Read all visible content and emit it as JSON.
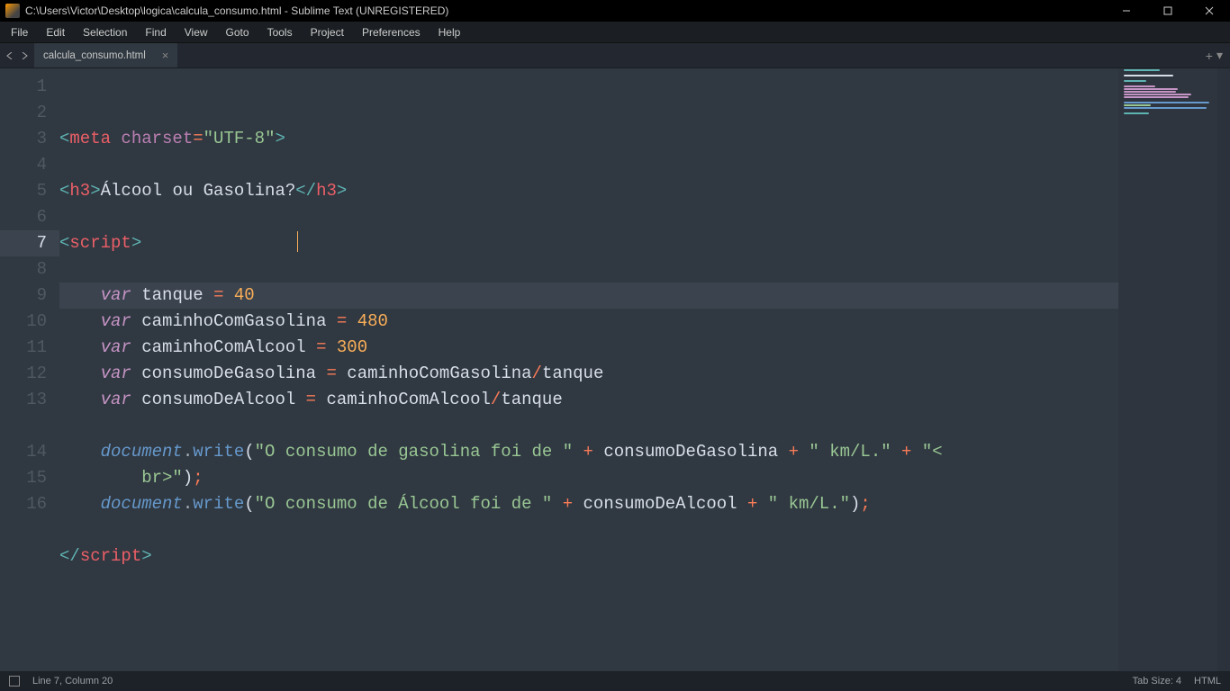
{
  "window": {
    "title": "C:\\Users\\Victor\\Desktop\\logica\\calcula_consumo.html - Sublime Text (UNREGISTERED)"
  },
  "menu": {
    "items": [
      "File",
      "Edit",
      "Selection",
      "Find",
      "View",
      "Goto",
      "Tools",
      "Project",
      "Preferences",
      "Help"
    ]
  },
  "tabs": {
    "active": {
      "label": "calcula_consumo.html"
    }
  },
  "status": {
    "position": "Line 7, Column 20",
    "tab_size": "Tab Size: 4",
    "syntax": "HTML"
  },
  "code": {
    "lines": [
      {
        "num": 1,
        "tokens": [
          [
            "p-ang",
            "<"
          ],
          [
            "p-tag",
            "meta"
          ],
          [
            "p-text",
            " "
          ],
          [
            "p-attr",
            "charset"
          ],
          [
            "p-op",
            "="
          ],
          [
            "p-str",
            "\"UTF-8\""
          ],
          [
            "p-ang",
            ">"
          ]
        ]
      },
      {
        "num": 2,
        "tokens": []
      },
      {
        "num": 3,
        "tokens": [
          [
            "p-ang",
            "<"
          ],
          [
            "p-tag",
            "h3"
          ],
          [
            "p-ang",
            ">"
          ],
          [
            "p-text",
            "Álcool ou Gasolina?"
          ],
          [
            "p-ang",
            "</"
          ],
          [
            "p-tag",
            "h3"
          ],
          [
            "p-ang",
            ">"
          ]
        ]
      },
      {
        "num": 4,
        "tokens": []
      },
      {
        "num": 5,
        "tokens": [
          [
            "p-ang",
            "<"
          ],
          [
            "p-tag",
            "script"
          ],
          [
            "p-ang",
            ">"
          ]
        ]
      },
      {
        "num": 6,
        "tokens": []
      },
      {
        "num": 7,
        "current": true,
        "indent": "    ",
        "tokens": [
          [
            "p-kw",
            "var"
          ],
          [
            "p-text",
            " "
          ],
          [
            "p-id",
            "tanque"
          ],
          [
            "p-text",
            " "
          ],
          [
            "p-op",
            "="
          ],
          [
            "p-text",
            " "
          ],
          [
            "p-num",
            "40"
          ]
        ]
      },
      {
        "num": 8,
        "indent": "    ",
        "tokens": [
          [
            "p-kw",
            "var"
          ],
          [
            "p-text",
            " "
          ],
          [
            "p-id",
            "caminhoComGasolina"
          ],
          [
            "p-text",
            " "
          ],
          [
            "p-op",
            "="
          ],
          [
            "p-text",
            " "
          ],
          [
            "p-num",
            "480"
          ]
        ]
      },
      {
        "num": 9,
        "indent": "    ",
        "tokens": [
          [
            "p-kw",
            "var"
          ],
          [
            "p-text",
            " "
          ],
          [
            "p-id",
            "caminhoComAlcool"
          ],
          [
            "p-text",
            " "
          ],
          [
            "p-op",
            "="
          ],
          [
            "p-text",
            " "
          ],
          [
            "p-num",
            "300"
          ]
        ]
      },
      {
        "num": 10,
        "indent": "    ",
        "tokens": [
          [
            "p-kw",
            "var"
          ],
          [
            "p-text",
            " "
          ],
          [
            "p-id",
            "consumoDeGasolina"
          ],
          [
            "p-text",
            " "
          ],
          [
            "p-op",
            "="
          ],
          [
            "p-text",
            " "
          ],
          [
            "p-id",
            "caminhoComGasolina"
          ],
          [
            "p-op",
            "/"
          ],
          [
            "p-id",
            "tanque"
          ]
        ]
      },
      {
        "num": 11,
        "indent": "    ",
        "tokens": [
          [
            "p-kw",
            "var"
          ],
          [
            "p-text",
            " "
          ],
          [
            "p-id",
            "consumoDeAlcool"
          ],
          [
            "p-text",
            " "
          ],
          [
            "p-op",
            "="
          ],
          [
            "p-text",
            " "
          ],
          [
            "p-id",
            "caminhoComAlcool"
          ],
          [
            "p-op",
            "/"
          ],
          [
            "p-id",
            "tanque"
          ]
        ]
      },
      {
        "num": 12,
        "tokens": []
      },
      {
        "num": 13,
        "indent": "    ",
        "tokens": [
          [
            "p-obj",
            "document"
          ],
          [
            "p-dot",
            "."
          ],
          [
            "p-fn",
            "write"
          ],
          [
            "p-text",
            "("
          ],
          [
            "p-str",
            "\"O consumo de gasolina foi de \""
          ],
          [
            "p-text",
            " "
          ],
          [
            "p-op",
            "+"
          ],
          [
            "p-text",
            " "
          ],
          [
            "p-id",
            "consumoDeGasolina"
          ],
          [
            "p-text",
            " "
          ],
          [
            "p-op",
            "+"
          ],
          [
            "p-text",
            " "
          ],
          [
            "p-str",
            "\" km/L.\""
          ],
          [
            "p-text",
            " "
          ],
          [
            "p-op",
            "+"
          ],
          [
            "p-text",
            " "
          ],
          [
            "p-str",
            "\"<"
          ]
        ],
        "wrap": {
          "indent": "        ",
          "tokens": [
            [
              "p-str",
              "br>\""
            ],
            [
              "p-text",
              ")"
            ],
            [
              "p-op",
              ";"
            ]
          ]
        }
      },
      {
        "num": 14,
        "indent": "    ",
        "tokens": [
          [
            "p-obj",
            "document"
          ],
          [
            "p-dot",
            "."
          ],
          [
            "p-fn",
            "write"
          ],
          [
            "p-text",
            "("
          ],
          [
            "p-str",
            "\"O consumo de Álcool foi de \""
          ],
          [
            "p-text",
            " "
          ],
          [
            "p-op",
            "+"
          ],
          [
            "p-text",
            " "
          ],
          [
            "p-id",
            "consumoDeAlcool"
          ],
          [
            "p-text",
            " "
          ],
          [
            "p-op",
            "+"
          ],
          [
            "p-text",
            " "
          ],
          [
            "p-str",
            "\" km/L.\""
          ],
          [
            "p-text",
            ")"
          ],
          [
            "p-op",
            ";"
          ]
        ]
      },
      {
        "num": 15,
        "tokens": []
      },
      {
        "num": 16,
        "tokens": [
          [
            "p-ang",
            "</"
          ],
          [
            "p-tag",
            "script"
          ],
          [
            "p-ang",
            ">"
          ]
        ]
      }
    ]
  }
}
